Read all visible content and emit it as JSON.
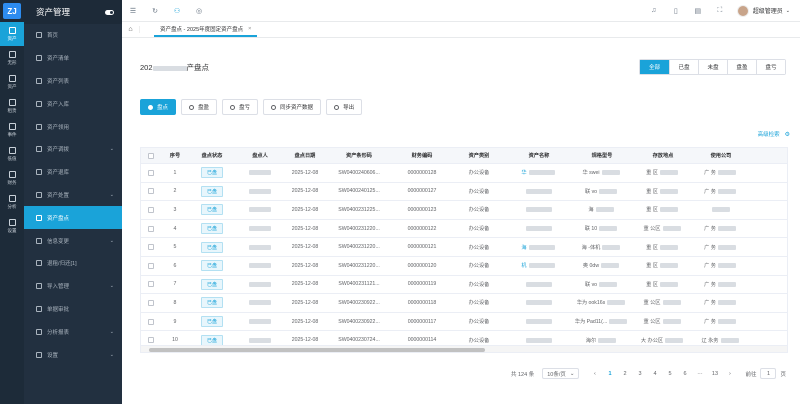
{
  "rail": {
    "logo": "ZJ",
    "items": [
      {
        "label": "资产",
        "icon": "asset-icon",
        "active": true
      },
      {
        "label": "无形",
        "icon": "intangible-icon"
      },
      {
        "label": "资产",
        "icon": "asset-list-icon"
      },
      {
        "label": "租赁",
        "icon": "lease-icon"
      },
      {
        "label": "事件",
        "icon": "event-icon"
      },
      {
        "label": "低值",
        "icon": "low-value-icon"
      },
      {
        "label": "财务",
        "icon": "finance-icon"
      },
      {
        "label": "分析",
        "icon": "analysis-icon"
      },
      {
        "label": "设置",
        "icon": "settings-icon"
      }
    ]
  },
  "sidebar": {
    "title": "资产管理",
    "items": [
      {
        "label": "首页",
        "icon": "home-icon",
        "chevron": ""
      },
      {
        "label": "资产清单",
        "icon": "list-icon",
        "chevron": ""
      },
      {
        "label": "资产列表",
        "icon": "table-icon",
        "chevron": ""
      },
      {
        "label": "资产入库",
        "icon": "inbound-icon",
        "chevron": ""
      },
      {
        "label": "资产领用",
        "icon": "receive-icon",
        "chevron": ""
      },
      {
        "label": "资产调拨",
        "icon": "transfer-icon",
        "chevron": "⌄"
      },
      {
        "label": "资产退库",
        "icon": "return-icon",
        "chevron": ""
      },
      {
        "label": "资产处置",
        "icon": "dispose-icon",
        "chevron": "⌄"
      },
      {
        "label": "资产盘点",
        "icon": "inventory-icon",
        "chevron": "",
        "active": true
      },
      {
        "label": "信息变更",
        "icon": "edit-icon",
        "chevron": "⌄"
      },
      {
        "label": "退租/归还[1]",
        "icon": "undo-icon",
        "chevron": ""
      },
      {
        "label": "导入管理",
        "icon": "import-icon",
        "chevron": "⌄"
      },
      {
        "label": "单据审批",
        "icon": "approve-icon",
        "chevron": ""
      },
      {
        "label": "分析报表",
        "icon": "report-icon",
        "chevron": "⌄"
      },
      {
        "label": "设置",
        "icon": "gear-icon",
        "chevron": "⌄"
      }
    ]
  },
  "topbar": {
    "icons": [
      "menu-icon",
      "refresh-icon",
      "sitemap-icon",
      "location-icon"
    ],
    "right_icons": [
      "bell-icon",
      "phone-icon",
      "document-icon",
      "fullscreen-icon"
    ],
    "username": "超级管理员"
  },
  "tabs": [
    {
      "label": "资产盘点 - 2025年度固定资产盘点",
      "close": "×"
    }
  ],
  "page": {
    "title_prefix": "202",
    "title_suffix": "产盘点",
    "filters": [
      {
        "label": "全部",
        "active": true
      },
      {
        "label": "已盘"
      },
      {
        "label": "未盘"
      },
      {
        "label": "盘盈"
      },
      {
        "label": "盘亏"
      }
    ],
    "actions": [
      {
        "label": "盘点",
        "primary": true
      },
      {
        "label": "盘盈"
      },
      {
        "label": "盘亏"
      },
      {
        "label": "同步资产数据"
      },
      {
        "label": "导出"
      }
    ],
    "advanced_search": "高级检索"
  },
  "table": {
    "columns": [
      "",
      "序号",
      "盘点状态",
      "盘点人",
      "盘点日期",
      "资产条形码",
      "财务编码",
      "资产类别",
      "资产名称",
      "规格型号",
      "存放地点",
      "使用公司"
    ],
    "rows": [
      {
        "no": "1",
        "status": "已盘",
        "date": "2025-12-08",
        "barcode": "SW0400240606...",
        "fin": "0000000128",
        "cat": "办公设备",
        "name": "华",
        "spec": "华 swei",
        "loc": "重 区",
        "company": "广 务"
      },
      {
        "no": "2",
        "status": "已盘",
        "date": "2025-12-08",
        "barcode": "SW0400240125...",
        "fin": "0000000127",
        "cat": "办公设备",
        "name": "",
        "spec": "联 vo",
        "loc": "重 区",
        "company": "广 务"
      },
      {
        "no": "3",
        "status": "已盘",
        "date": "2025-12-08",
        "barcode": "SW0400231225...",
        "fin": "0000000123",
        "cat": "办公设备",
        "name": "",
        "spec": "海",
        "loc": "重 区",
        "company": ""
      },
      {
        "no": "4",
        "status": "已盘",
        "date": "2025-12-08",
        "barcode": "SW0400231220...",
        "fin": "0000000122",
        "cat": "办公设备",
        "name": "",
        "spec": "联 10",
        "loc": "重 公区",
        "company": "广 务"
      },
      {
        "no": "5",
        "status": "已盘",
        "date": "2025-12-08",
        "barcode": "SW0400231220...",
        "fin": "0000000121",
        "cat": "办公设备",
        "name": "海",
        "spec": "海 -体机",
        "loc": "重 区",
        "company": "广 务"
      },
      {
        "no": "6",
        "status": "已盘",
        "date": "2025-12-08",
        "barcode": "SW0400231220...",
        "fin": "0000000120",
        "cat": "办公设备",
        "name": "机",
        "spec": "奥 0dw",
        "loc": "重 区",
        "company": "广 务"
      },
      {
        "no": "7",
        "status": "已盘",
        "date": "2025-12-08",
        "barcode": "SW0400231121...",
        "fin": "0000000119",
        "cat": "办公设备",
        "name": "",
        "spec": "联 vo",
        "loc": "重 区",
        "company": "广 务"
      },
      {
        "no": "8",
        "status": "已盘",
        "date": "2025-12-08",
        "barcode": "SW0400230922...",
        "fin": "0000000118",
        "cat": "办公设备",
        "name": "",
        "spec": "华为 ook16s",
        "loc": "重 公区",
        "company": "广 务"
      },
      {
        "no": "9",
        "status": "已盘",
        "date": "2025-12-08",
        "barcode": "SW0400230922...",
        "fin": "0000000117",
        "cat": "办公设备",
        "name": "",
        "spec": "华为 Pad11(...",
        "loc": "重 公区",
        "company": "广 务"
      },
      {
        "no": "10",
        "status": "已盘",
        "date": "2025-12-08",
        "barcode": "SW0400230724...",
        "fin": "0000000114",
        "cat": "办公设备",
        "name": "",
        "spec": "海尔",
        "loc": "大 办公区",
        "company": "辽 永务"
      }
    ]
  },
  "pagination": {
    "total": "共 124 条",
    "page_size": "10条/页",
    "prev": "‹",
    "pages": [
      "1",
      "2",
      "3",
      "4",
      "5",
      "6",
      "···",
      "13"
    ],
    "next": "›",
    "goto_label": "前往",
    "goto_value": "1",
    "page_unit": "页"
  },
  "colors": {
    "accent": "#1aa3d9",
    "sidebar": "#223040",
    "rail": "#1d2b39"
  }
}
